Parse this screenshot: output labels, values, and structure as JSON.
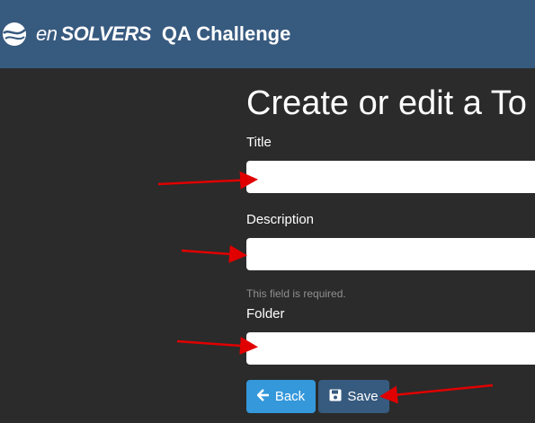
{
  "navbar": {
    "brand_en": "en",
    "brand_solvers": "SOLVERS",
    "brand_suffix": "QA Challenge"
  },
  "form": {
    "heading": "Create or edit a To",
    "title_label": "Title",
    "title_value": "",
    "description_label": "Description",
    "description_value": "",
    "required_text": "This field is required.",
    "folder_label": "Folder",
    "folder_value": ""
  },
  "buttons": {
    "back_label": "Back",
    "save_label": "Save"
  },
  "colors": {
    "navbar": "#375a7f",
    "background": "#2b2b2b",
    "back_button": "#3498db",
    "save_button": "#375a7f",
    "annotation_arrow": "#e00000"
  },
  "icons": [
    "ensolvers-logo-icon",
    "arrow-left-icon",
    "floppy-disk-icon"
  ]
}
